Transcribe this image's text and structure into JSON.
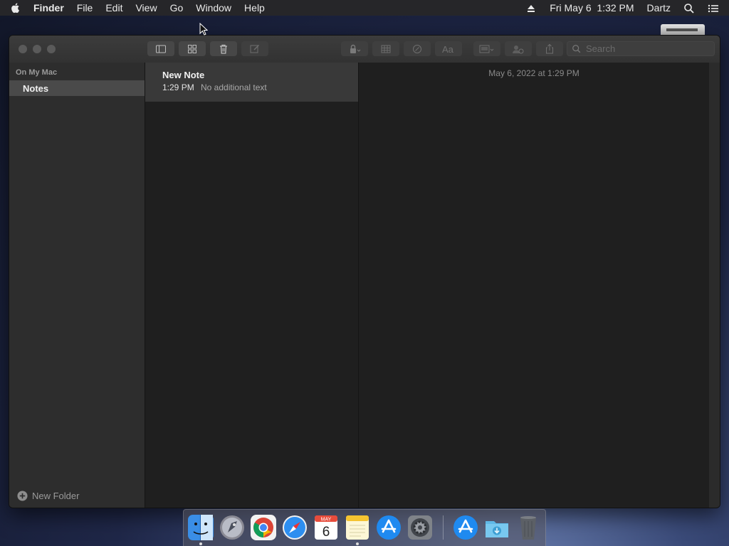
{
  "menubar": {
    "app_name": "Finder",
    "menus": [
      "File",
      "Edit",
      "View",
      "Go",
      "Window",
      "Help"
    ],
    "clock": "Fri May 6  1:32 PM",
    "user": "Dartz"
  },
  "notes_window": {
    "search_placeholder": "Search",
    "sidebar": {
      "section_header": "On My Mac",
      "folder_selected": "Notes",
      "new_folder_label": "New Folder"
    },
    "note_list": [
      {
        "title": "New Note",
        "time": "1:29 PM",
        "preview": "No additional text"
      }
    ],
    "editor": {
      "date": "May 6, 2022 at 1:29 PM"
    }
  },
  "dock": {
    "apps": [
      "finder",
      "launchpad",
      "chrome",
      "safari",
      "calendar",
      "notes",
      "app-store",
      "system-preferences",
      "app-store-2",
      "downloads-folder",
      "trash"
    ],
    "calendar_month": "MAY",
    "calendar_day": "6"
  },
  "colors": {
    "menubar_bg": "#262629",
    "window_bg": "#2b2b2b",
    "sidebar_selected": "#4a4a4a",
    "note_selected": "#393939"
  }
}
